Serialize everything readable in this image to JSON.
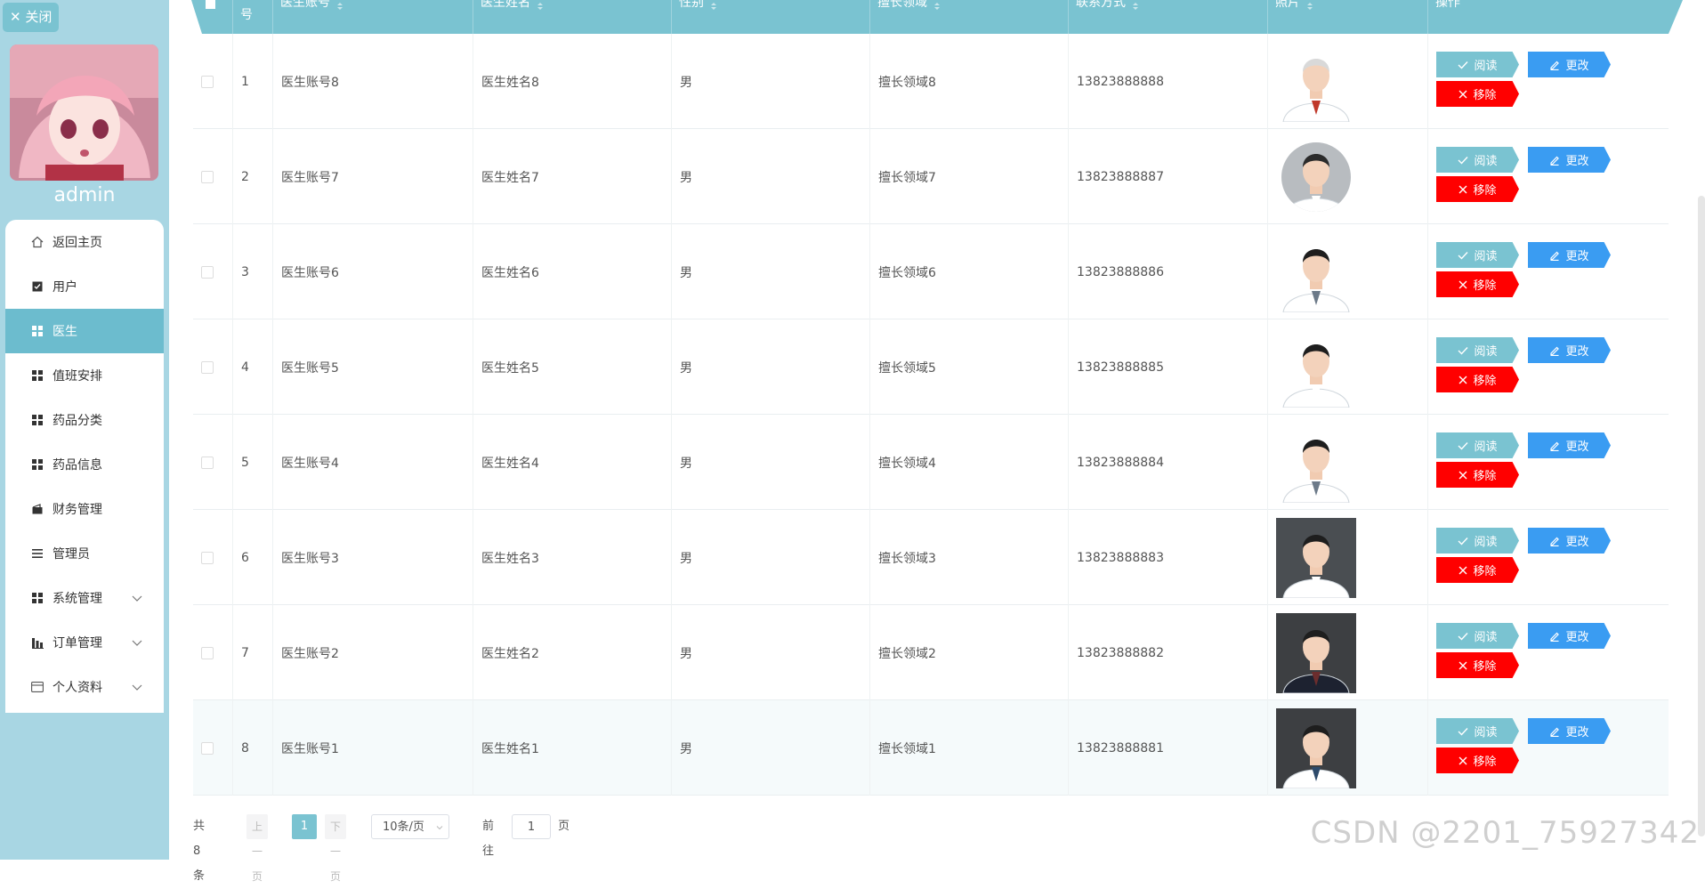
{
  "sidebar": {
    "close_label": "关闭",
    "username": "admin",
    "items": [
      {
        "label": "返回主页",
        "icon": "home-icon"
      },
      {
        "label": "用户",
        "icon": "checkbox-icon"
      },
      {
        "label": "医生",
        "icon": "grid-icon",
        "active": true
      },
      {
        "label": "值班安排",
        "icon": "grid-icon"
      },
      {
        "label": "药品分类",
        "icon": "grid-icon"
      },
      {
        "label": "药品信息",
        "icon": "grid-icon"
      },
      {
        "label": "财务管理",
        "icon": "wallet-icon"
      },
      {
        "label": "管理员",
        "icon": "list-icon"
      },
      {
        "label": "系统管理",
        "icon": "grid-icon",
        "expandable": true
      },
      {
        "label": "订单管理",
        "icon": "chart-icon",
        "expandable": true
      },
      {
        "label": "个人资料",
        "icon": "card-icon",
        "expandable": true
      }
    ]
  },
  "table": {
    "headers": [
      "号",
      "医生账号",
      "医生姓名",
      "性别",
      "擅长领域",
      "联系方式",
      "照片",
      "操作"
    ],
    "actions": {
      "read": "阅读",
      "edit": "更改",
      "delete": "移除"
    },
    "rows": [
      {
        "index": "1",
        "account": "医生账号8",
        "name": "医生姓名8",
        "gender": "男",
        "field": "擅长领域8",
        "phone": "13823888888"
      },
      {
        "index": "2",
        "account": "医生账号7",
        "name": "医生姓名7",
        "gender": "男",
        "field": "擅长领域7",
        "phone": "13823888887"
      },
      {
        "index": "3",
        "account": "医生账号6",
        "name": "医生姓名6",
        "gender": "男",
        "field": "擅长领域6",
        "phone": "13823888886"
      },
      {
        "index": "4",
        "account": "医生账号5",
        "name": "医生姓名5",
        "gender": "男",
        "field": "擅长领域5",
        "phone": "13823888885"
      },
      {
        "index": "5",
        "account": "医生账号4",
        "name": "医生姓名4",
        "gender": "男",
        "field": "擅长领域4",
        "phone": "13823888884"
      },
      {
        "index": "6",
        "account": "医生账号3",
        "name": "医生姓名3",
        "gender": "男",
        "field": "擅长领域3",
        "phone": "13823888883"
      },
      {
        "index": "7",
        "account": "医生账号2",
        "name": "医生姓名2",
        "gender": "男",
        "field": "擅长领域2",
        "phone": "13823888882"
      },
      {
        "index": "8",
        "account": "医生账号1",
        "name": "医生姓名1",
        "gender": "男",
        "field": "擅长领域1",
        "phone": "13823888881"
      }
    ]
  },
  "pagination": {
    "total": "共 8 条",
    "prev": "上一页",
    "current": "1",
    "next": "下一页",
    "page_size": "10条/页",
    "goto_prefix": "前往",
    "goto_value": "1",
    "goto_suffix": "页"
  },
  "watermark": "CSDN @2201_75927342",
  "colors": {
    "accent": "#7ac3d1",
    "edit": "#3a9cf2",
    "delete": "#ff0000",
    "sidebar": "#a8d6e3"
  }
}
